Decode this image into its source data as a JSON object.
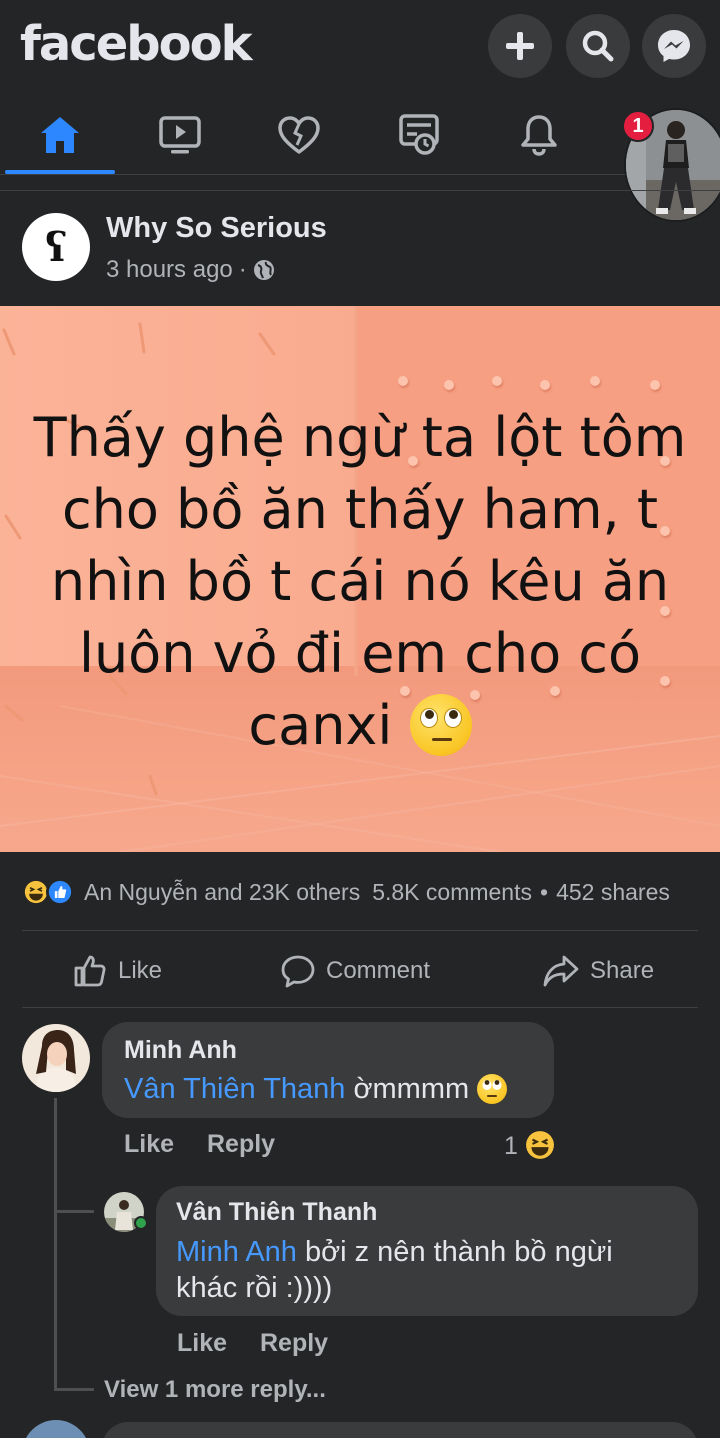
{
  "app": {
    "logo": "facebook",
    "accent_color": "#2d88ff",
    "background": "#242526"
  },
  "header": {
    "actions": [
      "plus-icon",
      "search-icon",
      "messenger-icon"
    ]
  },
  "nav": {
    "tabs": [
      "home-icon",
      "watch-icon",
      "dating-icon",
      "marketplace-icon",
      "notifications-icon",
      "profile-menu"
    ],
    "active_tab": "home-icon",
    "notification_count": "1"
  },
  "post": {
    "author": "Why So Serious",
    "avatar_glyph": "ʕ",
    "time": "3 hours ago",
    "separator": "·",
    "privacy_icon": "globe-icon",
    "image_text": "Thấy ghệ ngừ ta lột tôm cho bồ ăn thấy ham, t nhìn bồ t cái nó kêu ăn luôn vỏ đi em cho có canxi",
    "image_text_emoji": "face-with-rolling-eyes",
    "reactions_summary": "An Nguyễn and 23K others",
    "comments_count": "5.8K comments",
    "dot": "•",
    "shares_count": "452 shares",
    "reaction_icons": [
      "haha-icon",
      "like-icon"
    ]
  },
  "actions": {
    "like": "Like",
    "comment": "Comment",
    "share": "Share"
  },
  "comments": [
    {
      "author": "Minh Anh",
      "mention": "Vân Thiên Thanh",
      "text": " ờmmmm",
      "emoji": "face-with-rolling-eyes",
      "like": "Like",
      "reply": "Reply",
      "reaction_count": "1",
      "reaction_icon": "haha-icon"
    },
    {
      "author": "Vân Thiên Thanh",
      "mention": "Minh Anh",
      "text_line1": " bởi z nên thành bồ ngừi",
      "text_line2": "khác rồi :))))",
      "like": "Like",
      "reply": "Reply",
      "online": true
    }
  ],
  "view_more": "View 1 more reply..."
}
